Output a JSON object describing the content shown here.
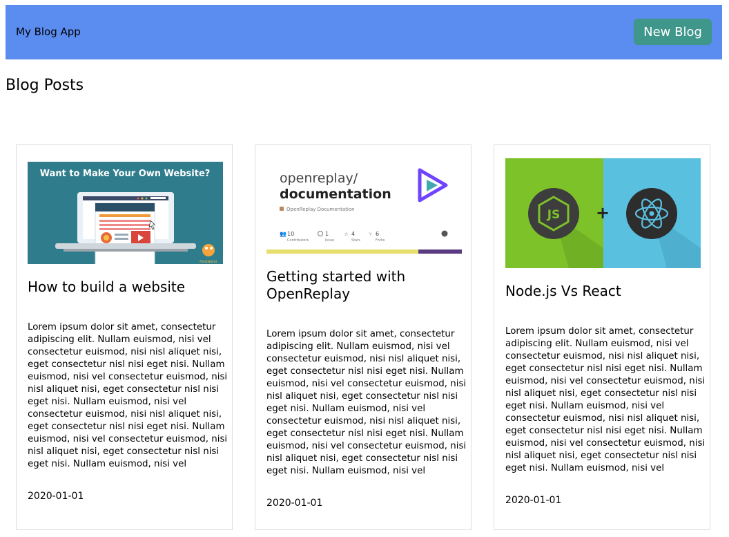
{
  "header": {
    "app_title": "My Blog App",
    "new_button_label": "New Blog"
  },
  "page": {
    "title": "Blog Posts"
  },
  "posts": [
    {
      "title": "How to build a website",
      "body": "Lorem ipsum dolor sit amet, consectetur adipiscing elit. Nullam euismod, nisi vel consectetur euismod, nisi nisl aliquet nisi, eget consectetur nisl nisi eget nisi. Nullam euismod, nisi vel consectetur euismod, nisi nisl aliquet nisi, eget consectetur nisl nisi eget nisi. Nullam euismod, nisi vel consectetur euismod, nisi nisl aliquet nisi, eget consectetur nisl nisi eget nisi. Nullam euismod, nisi vel consectetur euismod, nisi nisl aliquet nisi, eget consectetur nisl nisi eget nisi. Nullam euismod, nisi vel",
      "date": "2020-01-01",
      "image": {
        "headline": "Want to Make Your Own Website?",
        "logo_text": "HostGator"
      }
    },
    {
      "title": "Getting started with OpenReplay",
      "body": "Lorem ipsum dolor sit amet, consectetur adipiscing elit. Nullam euismod, nisi vel consectetur euismod, nisi nisl aliquet nisi, eget consectetur nisl nisi eget nisi. Nullam euismod, nisi vel consectetur euismod, nisi nisl aliquet nisi, eget consectetur nisl nisi eget nisi. Nullam euismod, nisi vel consectetur euismod, nisi nisl aliquet nisi, eget consectetur nisl nisi eget nisi. Nullam euismod, nisi vel consectetur euismod, nisi nisl aliquet nisi, eget consectetur nisl nisi eget nisi. Nullam euismod, nisi vel",
      "date": "2020-01-01",
      "image": {
        "owner": "openreplay/",
        "repo": "documentation",
        "description": "OpenReplay Documentation",
        "stats": [
          {
            "value": "10",
            "label": "Contributors"
          },
          {
            "value": "1",
            "label": "Issue"
          },
          {
            "value": "4",
            "label": "Stars"
          },
          {
            "value": "6",
            "label": "Forks"
          }
        ]
      }
    },
    {
      "title": "Node.js Vs React",
      "body": "Lorem ipsum dolor sit amet, consectetur adipiscing elit. Nullam euismod, nisi vel consectetur euismod, nisi nisl aliquet nisi, eget consectetur nisl nisi eget nisi. Nullam euismod, nisi vel consectetur euismod, nisi nisl aliquet nisi, eget consectetur nisl nisi eget nisi. Nullam euismod, nisi vel consectetur euismod, nisi nisl aliquet nisi, eget consectetur nisl nisi eget nisi. Nullam euismod, nisi vel consectetur euismod, nisi nisl aliquet nisi, eget consectetur nisl nisi eget nisi. Nullam euismod, nisi vel",
      "date": "2020-01-01",
      "image": {
        "left_logo": "JS",
        "separator": "+"
      }
    }
  ],
  "colors": {
    "navbar_bg": "#5b8cf0",
    "button_bg": "#3f968a",
    "card_border": "#dedede"
  }
}
